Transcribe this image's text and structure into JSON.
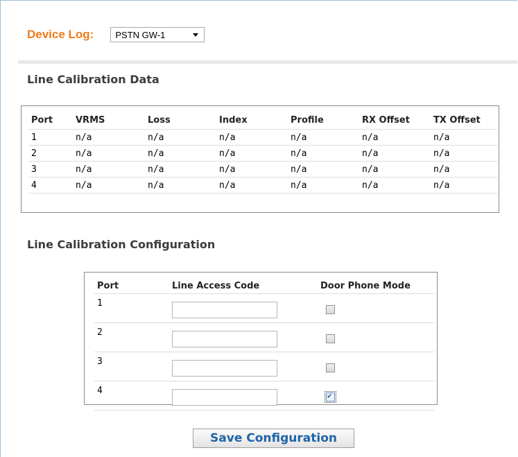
{
  "device_log": {
    "label": "Device Log:",
    "selected": "PSTN GW-1"
  },
  "calibration_data": {
    "title": "Line Calibration Data",
    "columns": [
      "Port",
      "VRMS",
      "Loss",
      "Index",
      "Profile",
      "RX Offset",
      "TX Offset"
    ],
    "rows": [
      [
        "1",
        "n/a",
        "n/a",
        "n/a",
        "n/a",
        "n/a",
        "n/a"
      ],
      [
        "2",
        "n/a",
        "n/a",
        "n/a",
        "n/a",
        "n/a",
        "n/a"
      ],
      [
        "3",
        "n/a",
        "n/a",
        "n/a",
        "n/a",
        "n/a",
        "n/a"
      ],
      [
        "4",
        "n/a",
        "n/a",
        "n/a",
        "n/a",
        "n/a",
        "n/a"
      ]
    ]
  },
  "calibration_config": {
    "title": "Line Calibration Configuration",
    "columns": [
      "Port",
      "Line Access Code",
      "Door Phone Mode"
    ],
    "rows": [
      {
        "port": "1",
        "access_code": "",
        "door_phone": false
      },
      {
        "port": "2",
        "access_code": "",
        "door_phone": false
      },
      {
        "port": "3",
        "access_code": "",
        "door_phone": false
      },
      {
        "port": "4",
        "access_code": "",
        "door_phone": true
      }
    ]
  },
  "save_button": {
    "label": "Save Configuration"
  },
  "colors": {
    "accent": "#f07a1a",
    "link_blue": "#1f63a8"
  }
}
